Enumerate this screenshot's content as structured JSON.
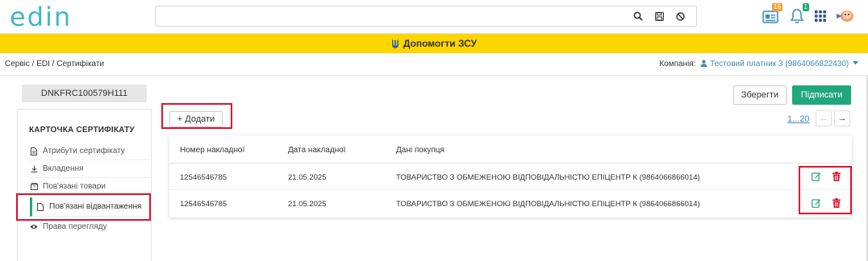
{
  "app": {
    "logo": "edin"
  },
  "header": {
    "search_placeholder": "",
    "icons": [
      "search-icon",
      "save-icon",
      "ban-icon",
      "news-icon",
      "bell-icon",
      "apps-icon",
      "avatar"
    ],
    "news_badge": "16",
    "bell_badge": "1",
    "colors": {
      "accent": "#3fb7c9",
      "banner": "#ffd500",
      "primary": "#22a77d",
      "danger": "#e0102c",
      "link": "#3c8dbc"
    }
  },
  "banner": {
    "text": "Допомогти ЗСУ"
  },
  "breadcrumb": {
    "text": "Сервіс / EDI / Сертифікати"
  },
  "company": {
    "label": "Компанія:",
    "name": "Тестовий платник 3 (9864066822430)"
  },
  "doc": {
    "number": "DNKFRC100579H111"
  },
  "sidebar": {
    "title": "КАРТОЧКА СЕРТИФІКАТУ",
    "items": [
      {
        "label": "Атрибути сертифікату",
        "icon": "file-icon"
      },
      {
        "label": "Вкладення",
        "icon": "download-icon"
      },
      {
        "label": "Пов'язані товари",
        "icon": "box-icon"
      },
      {
        "label": "Пов'язані відвантаження",
        "icon": "document-icon"
      },
      {
        "label": "Права перегляду",
        "icon": "eye-icon"
      }
    ]
  },
  "actions": {
    "save": "Зберегти",
    "sign": "Підписати",
    "add": "+ Додати"
  },
  "pager": {
    "range": "1...20",
    "prev": "←",
    "next": "→"
  },
  "table": {
    "columns": [
      "Номер накладної",
      "Дата накладної",
      "Дані покупця"
    ],
    "rows": [
      {
        "number": "12546546785",
        "date": "21.05.2025",
        "buyer": "ТОВАРИСТВО З ОБМЕЖЕНОЮ ВІДПОВІДАЛЬНІСТЮ ЕПІЦЕНТР К (9864066866014)"
      },
      {
        "number": "12546546785",
        "date": "21.05.2025",
        "buyer": "ТОВАРИСТВО З ОБМЕЖЕНОЮ ВІДПОВІДАЛЬНІСТЮ ЕПІЦЕНТР К (9864066866014)"
      }
    ]
  }
}
